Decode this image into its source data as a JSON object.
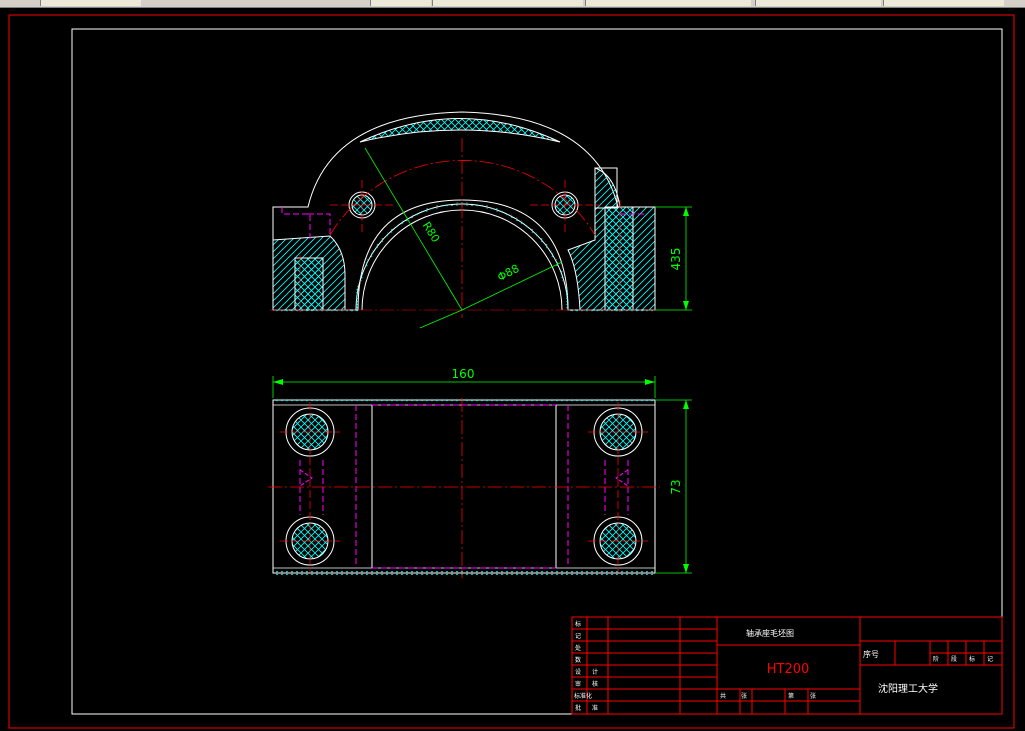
{
  "drawing": {
    "dimensions": {
      "height_front": "435",
      "radius_label": "R80",
      "diameter_label": "Φ88",
      "width_top": "160",
      "height_plan": "73"
    },
    "title_block": {
      "part_name": "轴承座毛坯图",
      "material": "HT200",
      "school": "沈阳理工大学",
      "seq_label": "序号",
      "row_labels": [
        "标",
        "记",
        "处",
        "数",
        "设",
        "计",
        "审",
        "核",
        "标准化",
        "批",
        "准"
      ],
      "bottom_labels": [
        "共",
        "张",
        "第",
        "张"
      ],
      "scale_labels": [
        "阶",
        "段",
        "标",
        "记"
      ]
    }
  },
  "colors": {
    "border": "#ff0000",
    "frame": "#ffffff",
    "center": "#ff0000",
    "dimension": "#00ff00",
    "hidden": "#ff00ff",
    "hatch": "#00ffff"
  }
}
